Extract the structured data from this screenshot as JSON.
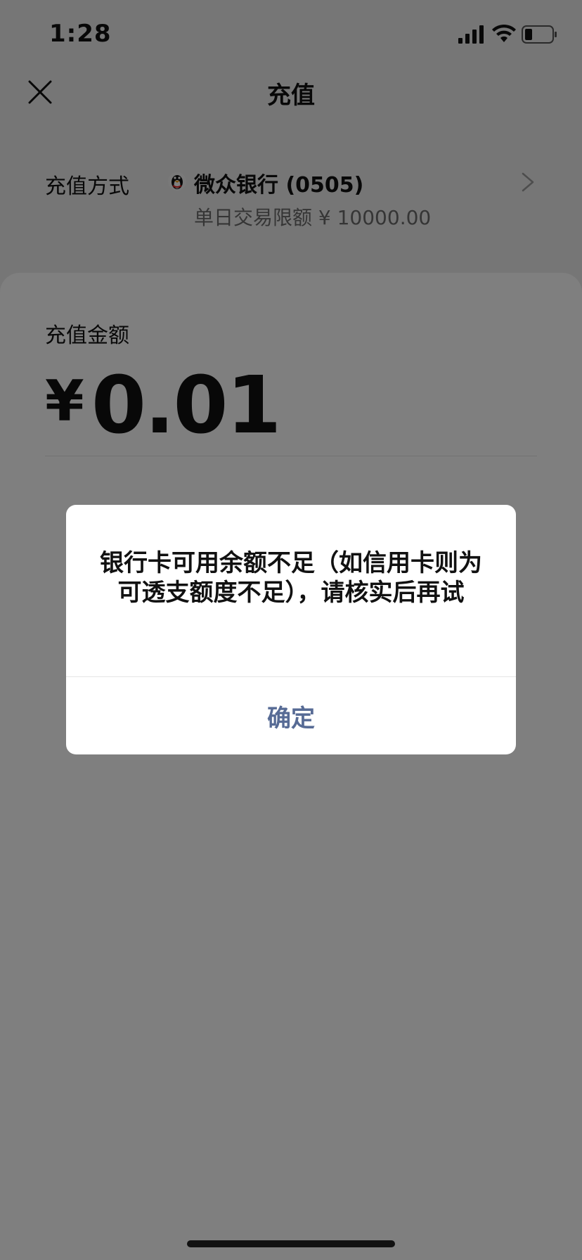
{
  "status_bar": {
    "time": "1:28"
  },
  "nav": {
    "title": "充值"
  },
  "recharge_method": {
    "label": "充值方式",
    "bank_name": "微众银行 (0505)",
    "limit": "单日交易限额 ¥ 10000.00"
  },
  "amount": {
    "label": "充值金额",
    "currency": "¥",
    "value": "0.01"
  },
  "dialog": {
    "message": "银行卡可用余额不足（如信用卡则为可透支额度不足），请核实后再试",
    "confirm_label": "确定"
  },
  "colors": {
    "dialog_button": "#576b95",
    "overlay": "rgba(0,0,0,0.5)",
    "background": "#ededed"
  }
}
